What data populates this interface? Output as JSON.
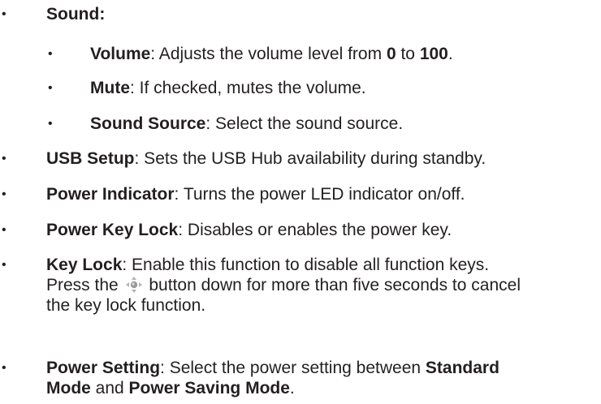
{
  "bullet": "•",
  "sound": {
    "label": "Sound:",
    "subitems": [
      {
        "label": "Volume",
        "sep": ": Adjusts the volume level from ",
        "from": "0",
        "to_word": " to ",
        "to": "100",
        "end": "."
      },
      {
        "label": "Mute",
        "text": ": If checked, mutes the volume."
      },
      {
        "label": "Sound Source",
        "text": ": Select the sound source."
      }
    ]
  },
  "items": [
    {
      "label": "USB Setup",
      "text": ": Sets the USB Hub availability during standby."
    },
    {
      "label": "Power Indicator",
      "text": ": Turns the power LED indicator on/off."
    },
    {
      "label": "Power Key Lock",
      "text": ": Disables or enables the power key."
    }
  ],
  "key_lock": {
    "label": "Key Lock",
    "text1": ": Enable this function to disable all function keys.",
    "text2_before": "Press the ",
    "icon": "joystick-icon",
    "text2_after": " button down for more than five seconds to cancel",
    "text3": "the key lock function."
  },
  "power_setting": {
    "label": "Power Setting",
    "text1": ": Select the power setting between ",
    "mode1a": "Standard",
    "mode1b": "Mode",
    "and": " and ",
    "mode2": "Power Saving Mode",
    "end": "."
  }
}
